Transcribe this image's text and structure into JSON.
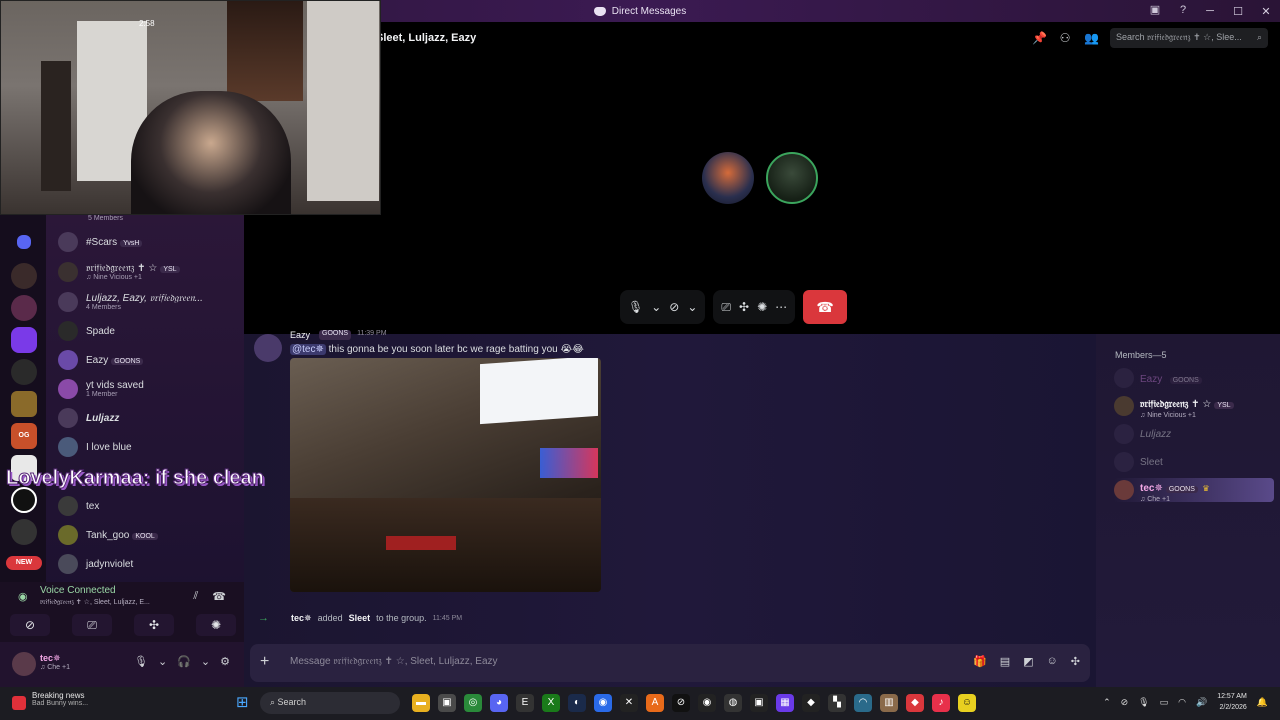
{
  "window": {
    "title": "Direct Messages",
    "controls": [
      "─",
      "☐",
      "✕"
    ]
  },
  "call": {
    "title": "Sleet, Luljazz, Eazy",
    "search_placeholder": "Search 𝔳𝔯𝔦𝔣𝔦𝔢𝔡𝔤𝔯𝔢𝔢𝔫𝔷 ✝ ☆, Slee..."
  },
  "webcam": {
    "clock": "2:58"
  },
  "dm_list": [
    {
      "name": "",
      "sub": "5 Members"
    },
    {
      "name": "#Scars",
      "tag": "YvsH"
    },
    {
      "name": "𝔳𝔯𝔦𝔣𝔦𝔢𝔡𝔤𝔯𝔢𝔢𝔫𝔷 ✝ ☆",
      "tag": "YSL",
      "sub": "♫ Nine Vicious +1"
    },
    {
      "name": "Luljazz, Eazy, 𝔳𝔯𝔦𝔣𝔦𝔢𝔡𝔤𝔯𝔢𝔢𝔫...",
      "sub": "4 Members"
    },
    {
      "name": "Spade"
    },
    {
      "name": "Eazy",
      "tag": "GOONS"
    },
    {
      "name": "yt vids saved",
      "sub": "1 Member"
    },
    {
      "name": "Luljazz"
    },
    {
      "name": "I love blue"
    },
    {
      "name": "tex"
    },
    {
      "name": "Tank_goo",
      "tag": "KOOL"
    },
    {
      "name": "jadynviolet"
    }
  ],
  "stream_overlay": "LovelyKarmaa: if she clean",
  "voice": {
    "status": "Voice Connected",
    "channel": "𝔳𝔯𝔦𝔣𝔦𝔢𝔡𝔤𝔯𝔢𝔢𝔫𝔷 ✝ ☆, Sleet, Luljazz, E..."
  },
  "user": {
    "name": "tec✵",
    "status": "♫ Che +1"
  },
  "servers": {
    "new_badge": "NEW",
    "og_hub": "OG HUB"
  },
  "chat": {
    "message": {
      "author": "Eazy",
      "tag": "GOONS",
      "time": "11:39 PM",
      "mention": "@tec✵",
      "text": "this gonna be you soon later bc we rage batting you 😭😂"
    },
    "system": {
      "actor": "tec✵",
      "verb": "added",
      "target": "Sleet",
      "suffix": "to the group.",
      "time": "11:45 PM"
    },
    "composer_placeholder": "Message 𝔳𝔯𝔦𝔣𝔦𝔢𝔡𝔤𝔯𝔢𝔢𝔫𝔷 ✝ ☆, Sleet, Luljazz, Eazy"
  },
  "members": {
    "title": "Members—5",
    "list": [
      {
        "name": "Eazy",
        "tag": "GOONS",
        "color": "#c77dd8"
      },
      {
        "name": "𝔳𝔯𝔦𝔣𝔦𝔢𝔡𝔤𝔯𝔢𝔢𝔫𝔷 ✝ ☆",
        "tag": "YSL",
        "sub": "♫ Nine Vicious +1",
        "color": "#f2f3f5"
      },
      {
        "name": "Luljazz",
        "color": "#b5bac1"
      },
      {
        "name": "Sleet",
        "color": "#b5bac1"
      },
      {
        "name": "tec✵",
        "tag": "GOONS",
        "sub": "♫ Che +1",
        "color": "#f3a8e6"
      }
    ]
  },
  "taskbar": {
    "news_title": "Breaking news",
    "news_sub": "Bad Bunny wins...",
    "search": "Search",
    "time": "12:57 AM",
    "date": "2/2/2026"
  },
  "colors": {
    "accent": "#5865f2",
    "danger": "#da373c",
    "online": "#3ba55d"
  }
}
